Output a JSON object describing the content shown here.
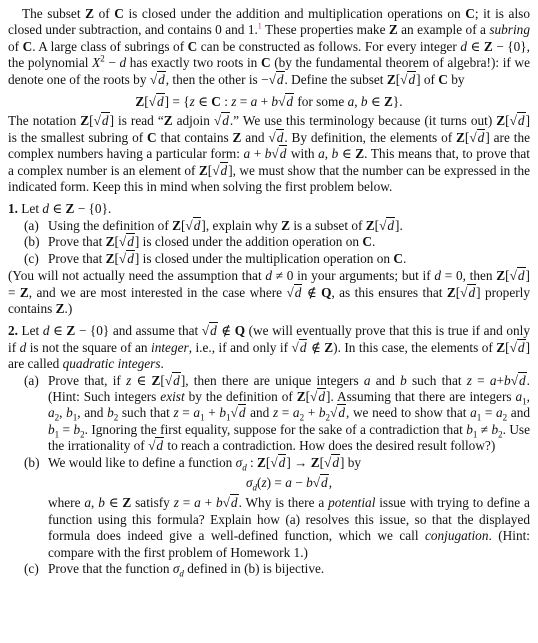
{
  "intro": {
    "p1_a": "The subset ",
    "Z": "Z",
    "C": "C",
    "p1_b": " of ",
    "p1_c": " is closed under the addition and multiplication operations on ",
    "p1_d": "; it is also closed under subtraction, and contains 0 and 1.",
    "footnote_mark": "1",
    "p1_e": " These properties make ",
    "p1_f": " an example of a ",
    "subring": "subring",
    "p1_g": " of ",
    "p1_h": ". A large class of subrings of ",
    "p1_i": " can be constructed as follows. For every integer ",
    "d": "d",
    "p1_j": " ∈ ",
    "p1_k": " − {0}, the polynomial ",
    "X": "X",
    "p1_l": " − ",
    "p1_m": " has exactly two roots in ",
    "p1_n": " (by the fundamental theorem of algebra!): if we denote one of the roots by ",
    "p1_o": ", then the other is −",
    "p1_p": ". Define the subset ",
    "p1_q": " of ",
    "p1_r": " by"
  },
  "display1": {
    "lhs_tail": "] = {",
    "z": "z",
    "in": " ∈ ",
    "colon": " : ",
    "eq": " = ",
    "a": "a",
    "plus": " + ",
    "b": "b",
    "for_some": " for some ",
    "comma": ", ",
    "close": "}."
  },
  "notation": {
    "t1": "The notation ",
    "t2": " is read “",
    "t3": " adjoin ",
    "t4": ".” We use this terminology because (it turns out) ",
    "t5": " is the smallest subring of ",
    "t6": " that contains ",
    "t7": " and ",
    "t8": ". By definition, the elements of ",
    "t9": " are the complex numbers having a particular form: ",
    "t10": " with ",
    "t11": ". This means that, to prove that a complex number is an element of ",
    "t12": ", we must show that the number can be expressed in the indicated form. Keep this in mind when solving the first problem below."
  },
  "problem1": {
    "number": "1.",
    "lead_a": " Let ",
    "lead_b": " − {0}.",
    "parts": [
      {
        "label": "(a)",
        "t1": "Using the definition of ",
        "t2": ", explain why ",
        "t3": " is a subset of ",
        "t4": "."
      },
      {
        "label": "(b)",
        "t1": "Prove that ",
        "t2": " is closed under the addition operation on ",
        "t3": "."
      },
      {
        "label": "(c)",
        "t1": "Prove that ",
        "t2": " is closed under the multiplication operation on ",
        "t3": "."
      }
    ],
    "note": {
      "t1": "(You will not actually need the assumption that ",
      "t2": " ≠ 0 in your arguments; but if ",
      "t3": " = 0, then ",
      "t4": "] = ",
      "t5": ", and we are most interested in the case where ",
      "t6": " ∉ ",
      "Q": "Q",
      "t7": ", as this ensures that ",
      "t8": " properly contains ",
      "t9": ".)"
    }
  },
  "problem2": {
    "number": "2.",
    "t1": " Let ",
    "t2": " − {0} and assume that ",
    "t3": " ∉ ",
    "t4": " (we will eventually prove that this is true if and only if ",
    "t5": " is not the square of an ",
    "integer": "integer",
    "t6": ", i.e., if and only if ",
    "t7": "). In this case, the elements of ",
    "t8": " are called ",
    "quadratic_integers": "quadratic integers",
    "t9": ".",
    "part_a": {
      "label": "(a)",
      "t1": "Prove that, if ",
      "t2": ", then there are unique integers ",
      "t3": " and ",
      "t4": " such that ",
      "t5": ". (Hint: Such integers ",
      "exist": "exist",
      "t6": " by the definition of ",
      "t7": ". Assuming that there are integers ",
      "t8": ", and ",
      "t9": " such that ",
      "t10": " and ",
      "t11": ", we need to show that ",
      "t12": " and ",
      "t13": ". Ignoring the first equality, suppose for the sake of a contradiction that ",
      "t14": ". Use the irrationality of ",
      "t15": " to reach a contradiction. How does the desired result follow?)"
    },
    "part_b": {
      "label": "(b)",
      "t1": "We would like to define a function ",
      "sigma": "σ",
      "t2": " : ",
      "arrow": " → ",
      "t3": " by",
      "display_eq": "(z) = a − b",
      "t4": "where ",
      "t5": " satisfy ",
      "t6": ". Why is there a ",
      "potential": "potential",
      "t7": " issue with trying to define a function using this formula? Explain how (a) resolves this issue, so that the displayed formula does indeed give a well-defined function, which we call ",
      "conjugation": "conjugation",
      "t8": ". (Hint: compare with the first problem of Homework 1.)"
    },
    "part_c": {
      "label": "(c)",
      "t1": "Prove that the function ",
      "t2": " defined in (b) is bijective."
    }
  }
}
